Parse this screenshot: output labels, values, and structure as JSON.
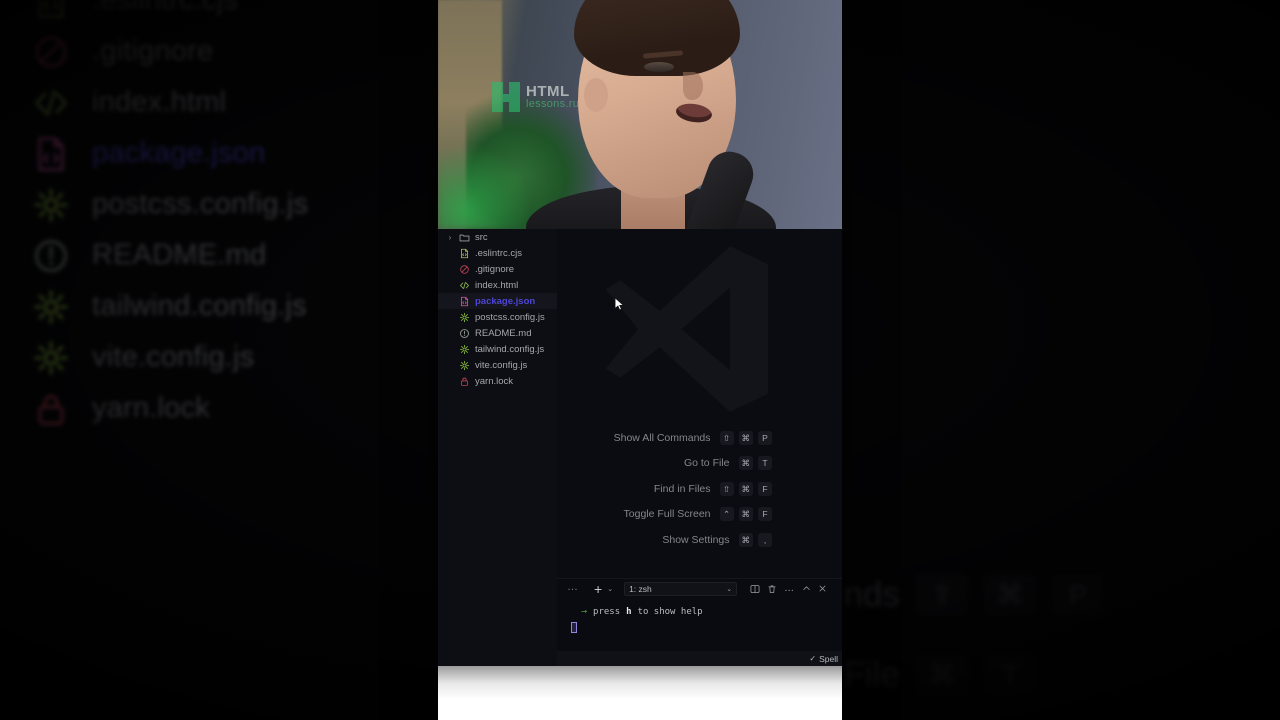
{
  "window": {
    "app": "Visual Studio Code",
    "background_description": "blurred zoomed duplicate of foreground"
  },
  "webcam": {
    "watermark_primary": "HTML",
    "watermark_secondary": "lessons.ru",
    "brand_color": "#2bbd6b"
  },
  "explorer": {
    "items": [
      {
        "label": "src",
        "icon": "folder-icon",
        "type": "folder",
        "expanded": false,
        "selected": false
      },
      {
        "label": ".eslintrc.cjs",
        "icon": "code-file-icon",
        "type": "file",
        "selected": false
      },
      {
        "label": ".gitignore",
        "icon": "prohibited-icon",
        "type": "file",
        "selected": false
      },
      {
        "label": "index.html",
        "icon": "html-icon",
        "type": "file",
        "selected": false
      },
      {
        "label": "package.json",
        "icon": "json-file-icon",
        "type": "file",
        "selected": true
      },
      {
        "label": "postcss.config.js",
        "icon": "gear-icon",
        "type": "file",
        "selected": false
      },
      {
        "label": "README.md",
        "icon": "info-icon",
        "type": "file",
        "selected": false
      },
      {
        "label": "tailwind.config.js",
        "icon": "gear-icon",
        "type": "file",
        "selected": false
      },
      {
        "label": "vite.config.js",
        "icon": "gear-icon",
        "type": "file",
        "selected": false
      },
      {
        "label": "yarn.lock",
        "icon": "lock-icon",
        "type": "file",
        "selected": false
      }
    ],
    "selected_color": "#4e46d6"
  },
  "editor": {
    "watermark_icon": "vscode-logo-icon",
    "shortcuts": [
      {
        "label": "Show All Commands",
        "keys": [
          "⇧",
          "⌘",
          "P"
        ]
      },
      {
        "label": "Go to File",
        "keys": [
          "⌘",
          "T"
        ]
      },
      {
        "label": "Find in Files",
        "keys": [
          "⇧",
          "⌘",
          "F"
        ]
      },
      {
        "label": "Toggle Full Screen",
        "keys": [
          "⌃",
          "⌘",
          "F"
        ]
      },
      {
        "label": "Show Settings",
        "keys": [
          "⌘",
          ","
        ]
      }
    ]
  },
  "panel": {
    "overflow_label": "…",
    "new_terminal_label": "+",
    "new_terminal_chevron": "⌄",
    "active_terminal": "1: zsh",
    "terminal_dropdown_chevron": "⌄",
    "actions": [
      {
        "name": "split-terminal-icon",
        "glyph": "⬚"
      },
      {
        "name": "kill-terminal-icon",
        "glyph": "🗑"
      },
      {
        "name": "more-actions-icon",
        "glyph": "…"
      },
      {
        "name": "maximize-panel-icon",
        "glyph": "˄"
      },
      {
        "name": "close-panel-icon",
        "glyph": "✕"
      }
    ],
    "terminal_line": {
      "arrow": "→",
      "text_before": "press",
      "highlight": "h",
      "text_after": "to show help"
    }
  },
  "statusbar": {
    "check": "✓",
    "spell_label": "Spell"
  },
  "background": {
    "file_rows": [
      {
        "label": ".eslintrc.cjs",
        "icon": "code-file-icon",
        "selected": false
      },
      {
        "label": ".gitignore",
        "icon": "prohibited-icon",
        "selected": false
      },
      {
        "label": "index.html",
        "icon": "html-icon",
        "selected": false
      },
      {
        "label": "package.json",
        "icon": "json-file-icon",
        "selected": true
      },
      {
        "label": "postcss.config.js",
        "icon": "gear-icon",
        "selected": false
      },
      {
        "label": "README.md",
        "icon": "info-icon",
        "selected": false
      },
      {
        "label": "tailwind.config.js",
        "icon": "gear-icon",
        "selected": false
      },
      {
        "label": "vite.config.js",
        "icon": "gear-icon",
        "selected": false
      },
      {
        "label": "yarn.lock",
        "icon": "lock-icon",
        "selected": false
      }
    ],
    "shortcut_rows": [
      {
        "label": "nds",
        "keys": [
          "⇧",
          "⌘",
          "P"
        ]
      },
      {
        "label": "File",
        "keys": [
          "⌘",
          "T"
        ]
      }
    ]
  }
}
